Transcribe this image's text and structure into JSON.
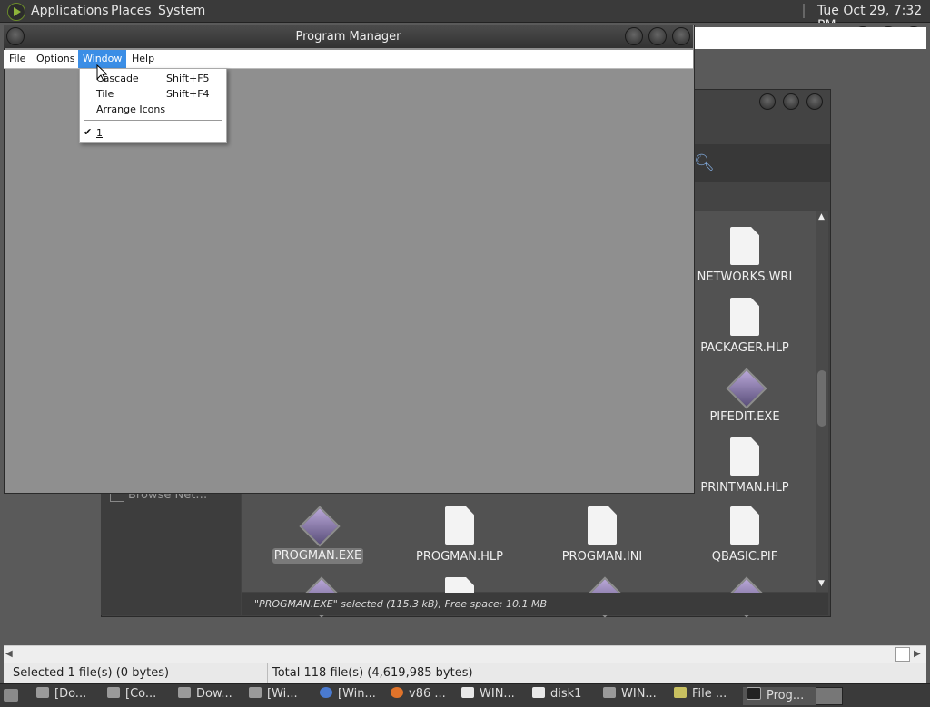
{
  "panel": {
    "menus": [
      "Applications",
      "Places",
      "System"
    ],
    "clock": "Tue Oct 29,  7:32 PM"
  },
  "program_manager": {
    "title": "Program Manager",
    "menus": [
      "File",
      "Options",
      "Window",
      "Help"
    ]
  },
  "window_menu": {
    "items": [
      {
        "label": "Cascade",
        "shortcut": "Shift+F5"
      },
      {
        "label": "Tile",
        "shortcut": "Shift+F4"
      },
      {
        "label": "Arrange Icons",
        "shortcut": ""
      }
    ],
    "checked_item": "1"
  },
  "file_manager": {
    "side_item": "Browse Net…",
    "files_right_column": [
      "NETWORKS.WRI",
      "PACKAGER.HLP",
      "PIFEDIT.EXE",
      "PRINTMAN.HLP"
    ],
    "files_row": [
      "PROGMAN.EXE",
      "PROGMAN.HLP",
      "PROGMAN.INI",
      "QBASIC.PIF"
    ],
    "selected_file": "PROGMAN.EXE",
    "status": "\"PROGMAN.EXE\" selected (115.3 kB), Free space: 10.1 MB"
  },
  "bg_status": {
    "left": "Selected 1 file(s) (0 bytes)",
    "right": "Total 118 file(s) (4,619,985 bytes)"
  },
  "taskbar": {
    "tasks": [
      "[Do...",
      "[Co...",
      "Dow...",
      "[Wi...",
      "[Win...",
      "v86 ...",
      "WIN...",
      "disk1",
      "WIN...",
      "File ...",
      "Prog..."
    ]
  }
}
